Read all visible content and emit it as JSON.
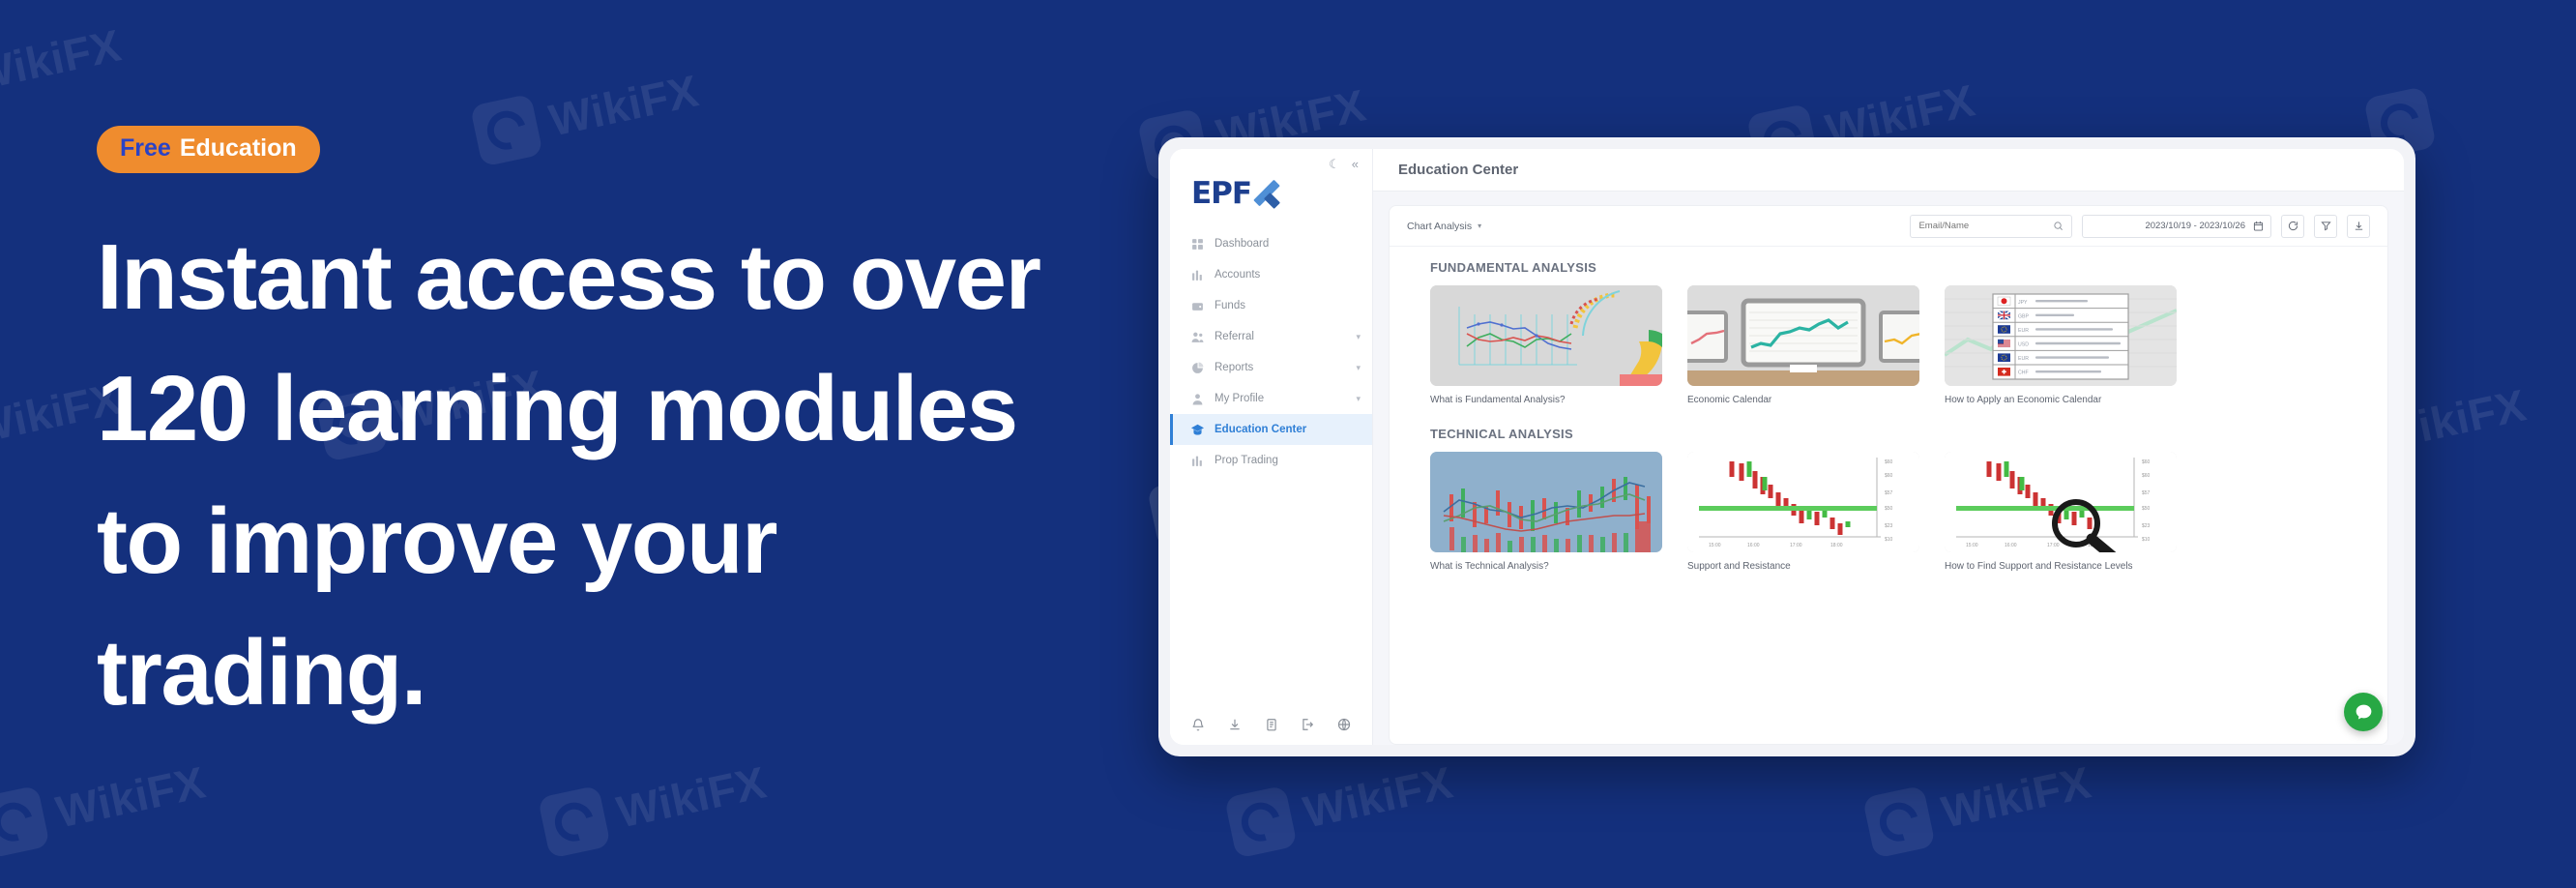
{
  "theme": {
    "bg": "#14307d",
    "badge_bg": "#ef8c2e",
    "badge_free_color": "#2a43c6",
    "accent": "#2f7fd6",
    "chat_green": "#27a844"
  },
  "watermark": {
    "text": "WikiFX",
    "icon": "wikifx-logo-icon"
  },
  "hero": {
    "badge": {
      "free": "Free",
      "rest": "Education"
    },
    "headline": "Instant access to over 120 learning modules to improve your trading."
  },
  "browser": {
    "sidebar": {
      "top_icons": [
        {
          "name": "moon-icon",
          "glyph": "☾"
        },
        {
          "name": "collapse-icon",
          "glyph": "«"
        }
      ],
      "logo": {
        "text": "EPF",
        "mark": "X"
      },
      "items": [
        {
          "label": "Dashboard",
          "icon": "grid-icon",
          "expandable": false,
          "active": false
        },
        {
          "label": "Accounts",
          "icon": "bars-icon",
          "expandable": false,
          "active": false
        },
        {
          "label": "Funds",
          "icon": "wallet-icon",
          "expandable": false,
          "active": false
        },
        {
          "label": "Referral",
          "icon": "users-icon",
          "expandable": true,
          "active": false
        },
        {
          "label": "Reports",
          "icon": "pie-icon",
          "expandable": true,
          "active": false
        },
        {
          "label": "My Profile",
          "icon": "user-icon",
          "expandable": true,
          "active": false
        },
        {
          "label": "Education Center",
          "icon": "graduation-icon",
          "expandable": false,
          "active": true
        },
        {
          "label": "Prop Trading",
          "icon": "bars-icon",
          "expandable": false,
          "active": false
        }
      ],
      "bottom_icons": [
        {
          "name": "bell-icon"
        },
        {
          "name": "download-icon"
        },
        {
          "name": "clipboard-icon"
        },
        {
          "name": "logout-icon"
        },
        {
          "name": "globe-icon"
        }
      ]
    },
    "header": {
      "title": "Education Center"
    },
    "toolbar": {
      "select_label": "Chart Analysis",
      "search_placeholder": "Email/Name",
      "search_value": "",
      "date_range": "2023/10/19 - 2023/10/26",
      "icons": [
        {
          "name": "calendar-icon"
        },
        {
          "name": "refresh-icon"
        },
        {
          "name": "filter-icon"
        },
        {
          "name": "download-icon"
        }
      ]
    },
    "sections": [
      {
        "title": "FUNDAMENTAL ANALYSIS",
        "cards": [
          {
            "caption": "What is Fundamental Analysis?",
            "thumb": "line-chart-donut"
          },
          {
            "caption": "Economic Calendar",
            "thumb": "monitors"
          },
          {
            "caption": "How to Apply an Economic Calendar",
            "thumb": "flag-table"
          }
        ]
      },
      {
        "title": "TECHNICAL ANALYSIS",
        "cards": [
          {
            "caption": "What is Technical Analysis?",
            "thumb": "candles-blue"
          },
          {
            "caption": "Support and Resistance",
            "thumb": "candles-support"
          },
          {
            "caption": "How to Find Support and Resistance Levels",
            "thumb": "candles-magnify"
          }
        ]
      }
    ],
    "flag_rows": [
      {
        "code": "JPY",
        "flag": "jp"
      },
      {
        "code": "GBP",
        "flag": "gb"
      },
      {
        "code": "EUR",
        "flag": "eu"
      },
      {
        "code": "USD",
        "flag": "us"
      },
      {
        "code": "EUR",
        "flag": "eu"
      },
      {
        "code": "CHF",
        "flag": "ch"
      }
    ],
    "support_chart": {
      "x_ticks": [
        "15:00",
        "16:00",
        "17:00",
        "18:00"
      ],
      "y_ticks": [
        "$60",
        "$57",
        "$50",
        "$23",
        "$10"
      ]
    },
    "chat_fab": {
      "name": "whatsapp-chat-icon"
    }
  }
}
